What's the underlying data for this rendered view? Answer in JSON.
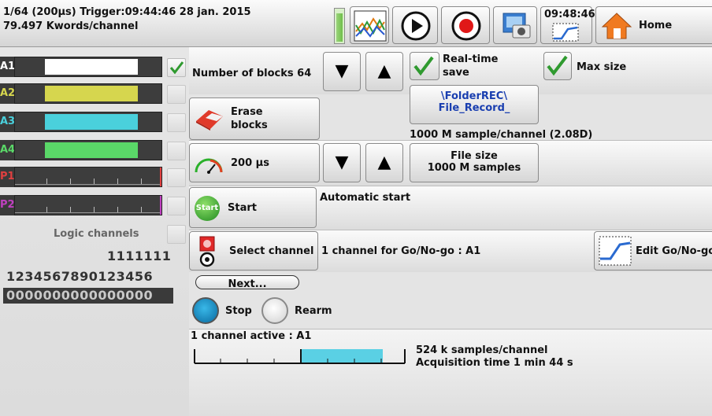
{
  "status": {
    "line1": "1/64 (200µs)  Trigger:09:44:46 28 jan. 2015",
    "line2": "79.497 Kwords/channel",
    "clock": "09:48:46",
    "home_label": "Home"
  },
  "channels": [
    {
      "label": "A1",
      "color": "#ffffff",
      "label_color": "#ffffff",
      "checked": true
    },
    {
      "label": "A2",
      "color": "#d6d64e",
      "label_color": "#d6d64e",
      "checked": false
    },
    {
      "label": "A3",
      "color": "#4ad0dc",
      "label_color": "#4ad0dc",
      "checked": false
    },
    {
      "label": "A4",
      "color": "#5ad868",
      "label_color": "#5ad868",
      "checked": false
    },
    {
      "label": "P1",
      "color": "",
      "label_color": "#e04040",
      "checked": false
    },
    {
      "label": "P2",
      "color": "",
      "label_color": "#c040c0",
      "checked": false
    }
  ],
  "logic": {
    "title": "Logic channels",
    "row1": "1111111",
    "row2": "1234567890123456",
    "row3": "0000000000000000"
  },
  "controls": {
    "blocks_label": "Number of blocks  64",
    "realtime_label_1": "Real-time",
    "realtime_label_2": "save",
    "maxsize_label": "Max size",
    "folder_line1": "\\FolderREC\\",
    "folder_line2": "File_Record_",
    "erase_line1": "Erase",
    "erase_line2": "blocks",
    "samples_info": "1000 M sample/channel  (2.08D)",
    "period_label": "200 µs",
    "filesize_line1": "File size",
    "filesize_line2": "1000 M samples",
    "start_label": "Start",
    "start_icon_text": "Start",
    "auto_start": "Automatic start",
    "select_channel": "Select channel",
    "gonogo_info": "1 channel for Go/No-go : A1",
    "edit_gonogo": "Edit Go/No-go",
    "next_label": "Next...",
    "stop_label": "Stop",
    "rearm_label": "Rearm",
    "active_info": "1 channel active : A1",
    "samples_per_channel": "524 k samples/channel",
    "acq_time": "Acquisition time 1 min 44 s"
  },
  "arrows": {
    "down": "▼",
    "up": "▲"
  },
  "colors": {
    "accent_blue": "#1a3fb0",
    "green_check": "#2f9a2f",
    "record_red": "#e01818"
  },
  "icons": [
    "battery-icon",
    "chart-icon",
    "play-icon",
    "record-icon",
    "camera-icon",
    "curve-icon",
    "home-icon",
    "eraser-icon",
    "gauge-icon",
    "start-icon",
    "channel-select-icon",
    "edit-curve-icon"
  ]
}
